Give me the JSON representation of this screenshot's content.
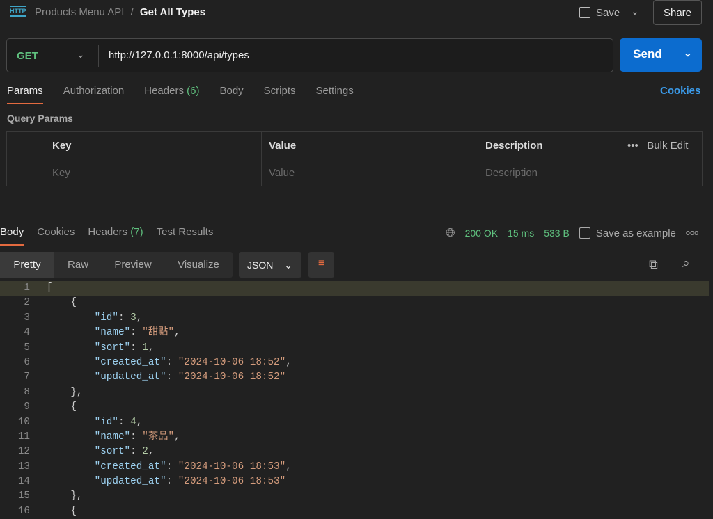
{
  "header": {
    "collection": "Products Menu API",
    "separator": "/",
    "request": "Get All Types",
    "save": "Save",
    "share": "Share",
    "icon": "http-icon"
  },
  "request": {
    "method": "GET",
    "url": "http://127.0.0.1:8000/api/types",
    "send": "Send"
  },
  "tabs": [
    {
      "label": "Params"
    },
    {
      "label": "Authorization"
    },
    {
      "label": "Headers",
      "count": "(6)"
    },
    {
      "label": "Body"
    },
    {
      "label": "Scripts"
    },
    {
      "label": "Settings"
    }
  ],
  "cookies": "Cookies",
  "query_params": {
    "title": "Query Params",
    "headers": [
      "Key",
      "Value",
      "Description"
    ],
    "bulk_edit": "Bulk Edit",
    "placeholders": [
      "Key",
      "Value",
      "Description"
    ]
  },
  "response": {
    "tabs": [
      {
        "label": "Body"
      },
      {
        "label": "Cookies"
      },
      {
        "label": "Headers",
        "count": "(7)"
      },
      {
        "label": "Test Results"
      }
    ],
    "status": "200 OK",
    "time": "15 ms",
    "size": "533 B",
    "save_example": "Save as example",
    "views": [
      "Pretty",
      "Raw",
      "Preview",
      "Visualize"
    ],
    "format": "JSON"
  },
  "code": [
    [
      [
        "p",
        "["
      ]
    ],
    [
      [
        "p",
        "    {"
      ]
    ],
    [
      [
        "p",
        "        "
      ],
      [
        "k",
        "\"id\""
      ],
      [
        "p",
        ": "
      ],
      [
        "n",
        "3"
      ],
      [
        "p",
        ","
      ]
    ],
    [
      [
        "p",
        "        "
      ],
      [
        "k",
        "\"name\""
      ],
      [
        "p",
        ": "
      ],
      [
        "s",
        "\"甜點\""
      ],
      [
        "p",
        ","
      ]
    ],
    [
      [
        "p",
        "        "
      ],
      [
        "k",
        "\"sort\""
      ],
      [
        "p",
        ": "
      ],
      [
        "n",
        "1"
      ],
      [
        "p",
        ","
      ]
    ],
    [
      [
        "p",
        "        "
      ],
      [
        "k",
        "\"created_at\""
      ],
      [
        "p",
        ": "
      ],
      [
        "s",
        "\"2024-10-06 18:52\""
      ],
      [
        "p",
        ","
      ]
    ],
    [
      [
        "p",
        "        "
      ],
      [
        "k",
        "\"updated_at\""
      ],
      [
        "p",
        ": "
      ],
      [
        "s",
        "\"2024-10-06 18:52\""
      ]
    ],
    [
      [
        "p",
        "    },"
      ]
    ],
    [
      [
        "p",
        "    {"
      ]
    ],
    [
      [
        "p",
        "        "
      ],
      [
        "k",
        "\"id\""
      ],
      [
        "p",
        ": "
      ],
      [
        "n",
        "4"
      ],
      [
        "p",
        ","
      ]
    ],
    [
      [
        "p",
        "        "
      ],
      [
        "k",
        "\"name\""
      ],
      [
        "p",
        ": "
      ],
      [
        "s",
        "\"茶品\""
      ],
      [
        "p",
        ","
      ]
    ],
    [
      [
        "p",
        "        "
      ],
      [
        "k",
        "\"sort\""
      ],
      [
        "p",
        ": "
      ],
      [
        "n",
        "2"
      ],
      [
        "p",
        ","
      ]
    ],
    [
      [
        "p",
        "        "
      ],
      [
        "k",
        "\"created_at\""
      ],
      [
        "p",
        ": "
      ],
      [
        "s",
        "\"2024-10-06 18:53\""
      ],
      [
        "p",
        ","
      ]
    ],
    [
      [
        "p",
        "        "
      ],
      [
        "k",
        "\"updated_at\""
      ],
      [
        "p",
        ": "
      ],
      [
        "s",
        "\"2024-10-06 18:53\""
      ]
    ],
    [
      [
        "p",
        "    },"
      ]
    ],
    [
      [
        "p",
        "    {"
      ]
    ]
  ]
}
